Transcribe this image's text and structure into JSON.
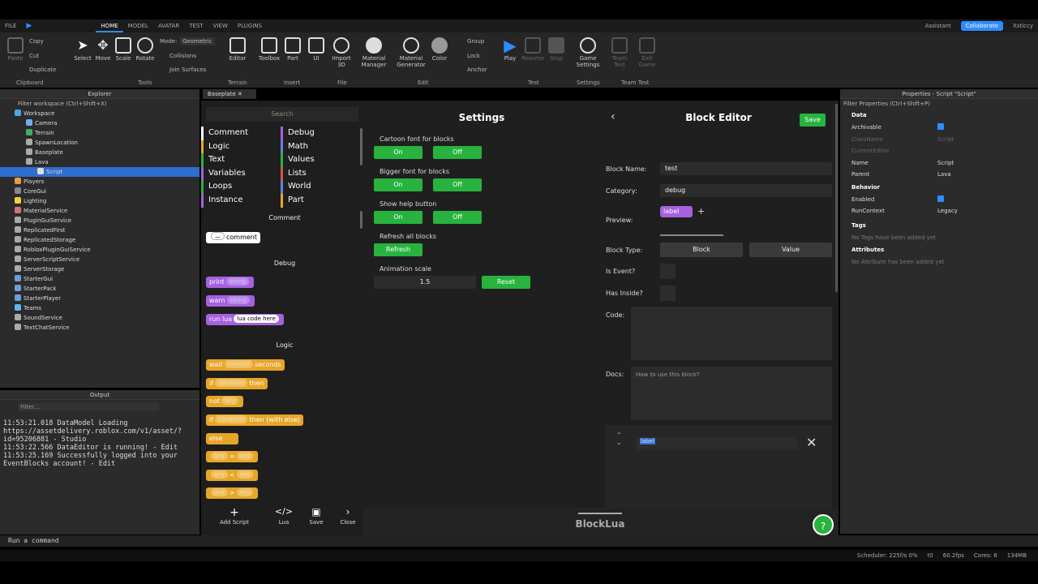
{
  "menu": [
    "FILE",
    "HOME",
    "MODEL",
    "AVATAR",
    "TEST",
    "VIEW",
    "PLUGINS"
  ],
  "top_right": {
    "assistant": "Assistant",
    "collaborate": "Collaborate",
    "user": "Xsticcy"
  },
  "ribbon": {
    "paste": "Paste",
    "copy": "Copy",
    "cut": "Cut",
    "duplicate": "Duplicate",
    "clipboard": "Clipboard",
    "select": "Select",
    "move": "Move",
    "scale": "Scale",
    "rotate": "Rotate",
    "mode_label": "Mode:",
    "mode_value": "Geometric",
    "collisions": "Collisions",
    "join_surfaces": "Join Surfaces",
    "tools": "Tools",
    "editor": "Editor",
    "terrain": "Terrain",
    "toolbox": "Toolbox",
    "part": "Part",
    "ui": "UI",
    "insert": "Insert",
    "import3d": "Import\n3D",
    "file": "File",
    "material_manager": "Material\nManager",
    "material_generator": "Material\nGenerator",
    "color": "Color",
    "group": "Group",
    "lock": "Lock",
    "anchor": "Anchor",
    "edit": "Edit",
    "play": "Play",
    "resume": "Resume",
    "stop": "Stop",
    "test": "Test",
    "game_settings": "Game\nSettings",
    "settings": "Settings",
    "team_test": "Team\nTest",
    "exit_game": "Exit\nGame",
    "team_test_group": "Team Test"
  },
  "explorer": {
    "title": "Explorer",
    "filter": "Filter workspace (Ctrl+Shift+X)",
    "items": [
      "Workspace",
      "Camera",
      "Terrain",
      "SpawnLocation",
      "Baseplate",
      "Lava",
      "Script",
      "Players",
      "CoreGui",
      "Lighting",
      "MaterialService",
      "PluginGuiService",
      "ReplicatedFirst",
      "ReplicatedStorage",
      "RobloxPluginGuiService",
      "ServerScriptService",
      "ServerStorage",
      "StarterGui",
      "StarterPack",
      "StarterPlayer",
      "Teams",
      "SoundService",
      "TextChatService"
    ]
  },
  "output": {
    "title": "Output",
    "filter": "Filter...",
    "lines": [
      {
        "time": "11:53:21.018",
        "text": "DataModel Loading https://assetdelivery.roblox.com/v1/asset/?id=95206881  -  Studio"
      },
      {
        "time": "11:53:22.566",
        "text": "DataEditor is running!  -  Edit"
      },
      {
        "time": "11:53:25.169",
        "text": "Successfully logged into your EventBlocks account!  -  Edit"
      }
    ]
  },
  "command_bar": "Run a command",
  "tab": {
    "label": "Baseplate"
  },
  "palette": {
    "search": "Search",
    "categories_left": [
      "Comment",
      "Logic",
      "Text",
      "Variables",
      "Loops",
      "Instance"
    ],
    "categories_right": [
      "Debug",
      "Math",
      "Values",
      "Lists",
      "World",
      "Part"
    ],
    "colors_left": [
      "#ffffff",
      "#e8a628",
      "#27b33e",
      "#a660e0",
      "#27b33e",
      "#a660e0"
    ],
    "colors_right": [
      "#a660e0",
      "#6a7fd8",
      "#27b33e",
      "#e04e4e",
      "#6a7fd8",
      "#e8a628"
    ],
    "sections": {
      "comment": "Comment",
      "debug": "Debug",
      "logic": "Logic"
    },
    "blocks": {
      "comment": "comment",
      "print": "print",
      "print_slot": "string",
      "warn": "warn",
      "warn_slot": "string",
      "run_lua": "run lua",
      "run_lua_slot": "lua code here",
      "wait": "wait",
      "wait_slot": "number",
      "seconds": "seconds",
      "if": "if",
      "if_slot": "condition",
      "then": "then",
      "not": "not",
      "any": "any",
      "if2": "if",
      "if2_slot": "condition",
      "then_else": "then (with else)",
      "else": "else",
      "eq": "=",
      "lt": "<",
      "gt": ">"
    },
    "bottom": [
      "Add Script",
      "Lua",
      "Save",
      "Close"
    ]
  },
  "settings": {
    "title": "Settings",
    "options": [
      {
        "label": "Cartoon font for blocks",
        "on": "On",
        "off": "Off"
      },
      {
        "label": "Bigger font for blocks",
        "on": "On",
        "off": "Off"
      },
      {
        "label": "Show help button",
        "on": "On",
        "off": "Off"
      }
    ],
    "refresh_label": "Refresh all blocks",
    "refresh_btn": "Refresh",
    "anim_label": "Animation scale",
    "anim_value": "1.5",
    "reset_btn": "Reset"
  },
  "editor": {
    "title": "Block Editor",
    "save": "Save",
    "block_name_label": "Block Name:",
    "block_name": "test",
    "category_label": "Category:",
    "category": "debug",
    "preview_label": "Preview:",
    "preview_block": "label",
    "block_type_label": "Block Type:",
    "block_btn": "Block",
    "value_btn": "Value",
    "is_event_label": "Is Event?",
    "has_inside_label": "Has Inside?",
    "code_label": "Code:",
    "docs_label": "Docs:",
    "docs_placeholder": "How to use this block?",
    "input_value": "label"
  },
  "footer": {
    "brand": "BlockLua",
    "help": "?"
  },
  "properties": {
    "title": "Properties - Script \"Script\"",
    "filter": "Filter Properties (Ctrl+Shift+P)",
    "data": "Data",
    "rows_data": [
      {
        "k": "Archivable",
        "v": ""
      },
      {
        "k": "ClassName",
        "v": "Script"
      },
      {
        "k": "CurrentEditor",
        "v": ""
      },
      {
        "k": "Name",
        "v": "Script"
      },
      {
        "k": "Parent",
        "v": "Lava"
      }
    ],
    "behavior": "Behavior",
    "rows_behavior": [
      {
        "k": "Enabled",
        "v": ""
      },
      {
        "k": "RunContext",
        "v": "Legacy"
      }
    ],
    "tags": "Tags",
    "tags_empty": "No Tags have been added yet",
    "attributes": "Attributes",
    "attr_empty": "No Attribute has been added yet"
  },
  "status": {
    "scheduler": "Scheduler: 225f/s 0%",
    "t0": "t0",
    "fps": "60.2fps",
    "cores": "Cores: 6",
    "mem": "134MB"
  }
}
